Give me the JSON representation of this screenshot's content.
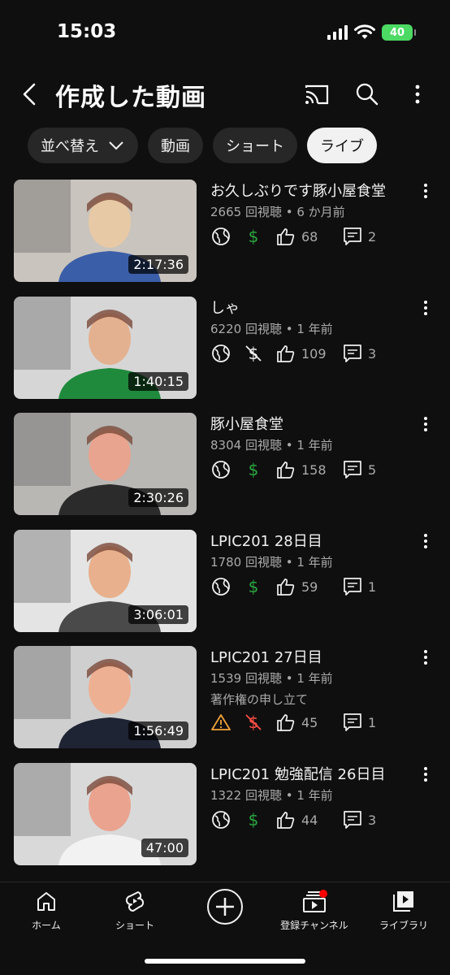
{
  "status": {
    "time": "15:03",
    "battery": "40"
  },
  "header": {
    "title": "作成した動画"
  },
  "chips": [
    {
      "label": "並べ替え"
    },
    {
      "label": "動画"
    },
    {
      "label": "ショート"
    },
    {
      "label": "ライブ",
      "selected": true
    }
  ],
  "videos": [
    {
      "title": "お久しぶりです豚小屋食堂",
      "views": "2665 回視聴",
      "age": "6 か月前",
      "duration": "2:17:36",
      "visibility": "public",
      "monetization": "on",
      "likes": "68",
      "comments": "2"
    },
    {
      "title": "しゃ",
      "views": "6220 回視聴",
      "age": "1 年前",
      "duration": "1:40:15",
      "visibility": "public",
      "monetization": "off",
      "likes": "109",
      "comments": "3"
    },
    {
      "title": "豚小屋食堂",
      "views": "8304 回視聴",
      "age": "1 年前",
      "duration": "2:30:26",
      "visibility": "public",
      "monetization": "on",
      "likes": "158",
      "comments": "5"
    },
    {
      "title": "LPIC201 28日目",
      "views": "1780 回視聴",
      "age": "1 年前",
      "duration": "3:06:01",
      "visibility": "public",
      "monetization": "on",
      "likes": "59",
      "comments": "1"
    },
    {
      "title": "LPIC201 27日目",
      "views": "1539 回視聴",
      "age": "1 年前",
      "duration": "1:56:49",
      "note": "著作権の申し立て",
      "visibility": "warning",
      "monetization": "restricted",
      "likes": "45",
      "comments": "1"
    },
    {
      "title": "LPIC201 勉強配信 26日目",
      "views": "1322 回視聴",
      "age": "1 年前",
      "duration": "47:00",
      "visibility": "public",
      "monetization": "on",
      "likes": "44",
      "comments": "3"
    }
  ],
  "meta_separator": " • ",
  "nav": [
    {
      "label": "ホーム",
      "icon": "home-icon"
    },
    {
      "label": "ショート",
      "icon": "shorts-icon"
    },
    {
      "label": "",
      "icon": "create-icon"
    },
    {
      "label": "登録チャンネル",
      "icon": "subscriptions-icon"
    },
    {
      "label": "ライブラリ",
      "icon": "library-icon"
    }
  ],
  "colors": {
    "background": "#0f0f0f",
    "chip": "#272727",
    "chip_active": "#f1f1f1",
    "monetized": "#2ba640",
    "demonetized": "#ff4e45",
    "warning": "#f2a33a",
    "notification": "#ff0000"
  }
}
